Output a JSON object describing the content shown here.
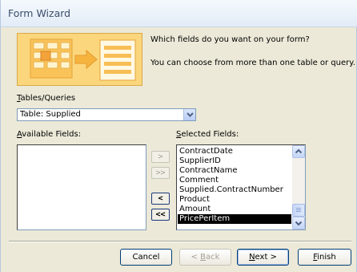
{
  "window": {
    "title": "Form Wizard"
  },
  "prompt": {
    "question": "Which fields do you want on your form?",
    "hint": "You can choose from more than one table or query."
  },
  "tables_queries": {
    "label_mnemonic": "T",
    "label_rest": "ables/Queries",
    "value": "Table: Supplied"
  },
  "available_fields": {
    "label_mnemonic": "A",
    "label_rest": "vailable Fields:",
    "items": []
  },
  "selected_fields": {
    "label_mnemonic": "S",
    "label_rest": "elected Fields:",
    "items": [
      "ContractDate",
      "SupplierID",
      "ContractName",
      "Comment",
      "Supplied.ContractNumber",
      "Product",
      "Amount",
      "PricePerItem"
    ],
    "selected_item": "PricePerItem"
  },
  "move_buttons": {
    "add_one": ">",
    "add_all": ">>",
    "remove_one": "<",
    "remove_all": "<<"
  },
  "buttons": {
    "cancel": "Cancel",
    "back_mnemonic": "B",
    "back_prefix": "< ",
    "back_rest": "ack",
    "next_mnemonic": "N",
    "next_rest": "ext >",
    "finish_mnemonic": "F",
    "finish_rest": "inish"
  },
  "colors": {
    "title_text": "#3b4e6b",
    "illustration": "#fbd67c",
    "selection_bg": "#000000",
    "selection_text": "#ffffff"
  }
}
